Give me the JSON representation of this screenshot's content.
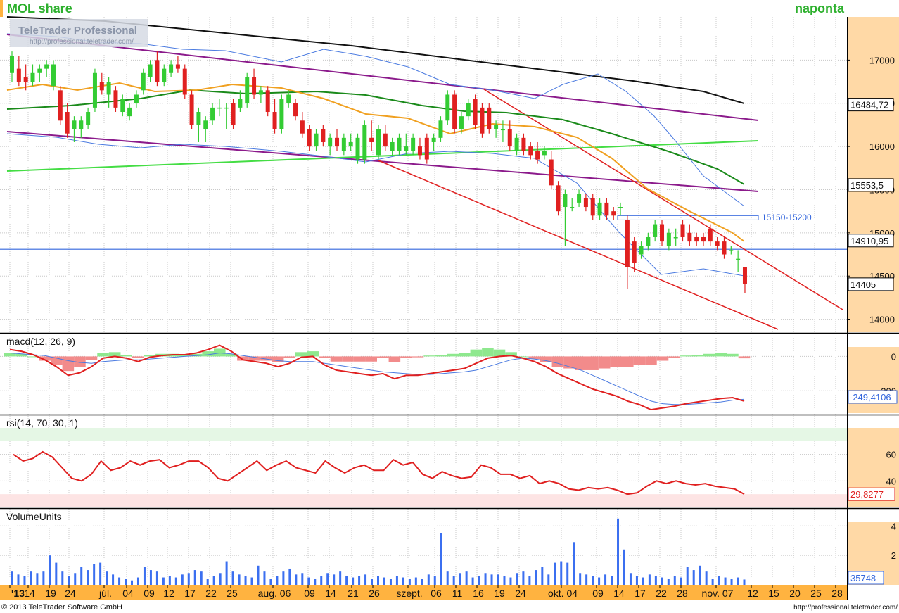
{
  "header": {
    "title": "MOL share",
    "period_label": "naponta",
    "watermark_line1": "TeleTrader Professional",
    "watermark_line2": "http://professional.teletrader.com/"
  },
  "footer": {
    "copyright": "© 2013 TeleTrader Software GmbH",
    "url": "http://professional.teletrader.com/"
  },
  "colors": {
    "up": "#33cc33",
    "down": "#e02020",
    "ma_black": "#111111",
    "ma_dark_green": "#1a8a1a",
    "ma_orange": "#f0a020",
    "bollinger": "#4a7ae0",
    "channel": "#8b1a8b",
    "trend_red": "#e02020",
    "support_blue": "#3366dd",
    "light_green": "#44dd44",
    "price_axis_bg": "#ffd9a6",
    "date_axis_bg": "#ffb340"
  },
  "chart_data": [
    {
      "type": "candlestick",
      "panel": "price",
      "ylim": [
        13850,
        17500
      ],
      "yticks": [
        14000,
        14500,
        15000,
        15500,
        16000,
        16500,
        17000
      ],
      "price_labels": [
        {
          "text": "16484,72",
          "value": 16484.72
        },
        {
          "text": "15553,5",
          "value": 15553.5
        },
        {
          "text": "14910,95",
          "value": 14910.95
        },
        {
          "text": "14405",
          "value": 14405
        }
      ],
      "annotation": {
        "text": "15150-15200",
        "low": 15150,
        "high": 15200
      },
      "support_level": 14810,
      "candles": [
        {
          "o": 16850,
          "h": 17100,
          "l": 16750,
          "c": 17050
        },
        {
          "o": 16900,
          "h": 17050,
          "l": 16700,
          "c": 16750
        },
        {
          "o": 16800,
          "h": 16950,
          "l": 16650,
          "c": 16750
        },
        {
          "o": 16750,
          "h": 16950,
          "l": 16700,
          "c": 16850
        },
        {
          "o": 16850,
          "h": 16950,
          "l": 16750,
          "c": 16900
        },
        {
          "o": 16900,
          "h": 17000,
          "l": 16800,
          "c": 16950
        },
        {
          "o": 16700,
          "h": 17000,
          "l": 16650,
          "c": 16950
        },
        {
          "o": 16650,
          "h": 16700,
          "l": 16250,
          "c": 16300
        },
        {
          "o": 16400,
          "h": 16500,
          "l": 16100,
          "c": 16150
        },
        {
          "o": 16200,
          "h": 16350,
          "l": 16050,
          "c": 16300
        },
        {
          "o": 16200,
          "h": 16350,
          "l": 16100,
          "c": 16300
        },
        {
          "o": 16250,
          "h": 16450,
          "l": 16200,
          "c": 16400
        },
        {
          "o": 16450,
          "h": 16900,
          "l": 16400,
          "c": 16850
        },
        {
          "o": 16750,
          "h": 16850,
          "l": 16600,
          "c": 16650
        },
        {
          "o": 16600,
          "h": 16800,
          "l": 16450,
          "c": 16750
        },
        {
          "o": 16650,
          "h": 16700,
          "l": 16400,
          "c": 16450
        },
        {
          "o": 16400,
          "h": 16600,
          "l": 16350,
          "c": 16550
        },
        {
          "o": 16350,
          "h": 16500,
          "l": 16300,
          "c": 16450
        },
        {
          "o": 16500,
          "h": 16650,
          "l": 16450,
          "c": 16600
        },
        {
          "o": 16650,
          "h": 16900,
          "l": 16600,
          "c": 16850
        },
        {
          "o": 16800,
          "h": 17000,
          "l": 16750,
          "c": 16950
        },
        {
          "o": 17000,
          "h": 17100,
          "l": 16700,
          "c": 16750
        },
        {
          "o": 16750,
          "h": 16950,
          "l": 16700,
          "c": 16900
        },
        {
          "o": 16850,
          "h": 17000,
          "l": 16800,
          "c": 16950
        },
        {
          "o": 16950,
          "h": 17050,
          "l": 16850,
          "c": 16900
        },
        {
          "o": 16900,
          "h": 16950,
          "l": 16550,
          "c": 16600
        },
        {
          "o": 16600,
          "h": 16650,
          "l": 16200,
          "c": 16250
        },
        {
          "o": 16250,
          "h": 16450,
          "l": 16050,
          "c": 16400
        },
        {
          "o": 16200,
          "h": 16350,
          "l": 16050,
          "c": 16300
        },
        {
          "o": 16300,
          "h": 16500,
          "l": 16250,
          "c": 16450
        },
        {
          "o": 16450,
          "h": 16550,
          "l": 16350,
          "c": 16450
        },
        {
          "o": 16450,
          "h": 16500,
          "l": 16200,
          "c": 16450
        },
        {
          "o": 16500,
          "h": 16550,
          "l": 16200,
          "c": 16250
        },
        {
          "o": 16450,
          "h": 16650,
          "l": 16400,
          "c": 16550
        },
        {
          "o": 16500,
          "h": 16850,
          "l": 16450,
          "c": 16800
        },
        {
          "o": 16800,
          "h": 16900,
          "l": 16550,
          "c": 16600
        },
        {
          "o": 16600,
          "h": 16700,
          "l": 16500,
          "c": 16650
        },
        {
          "o": 16650,
          "h": 16700,
          "l": 16350,
          "c": 16400
        },
        {
          "o": 16400,
          "h": 16550,
          "l": 16150,
          "c": 16200
        },
        {
          "o": 16200,
          "h": 16600,
          "l": 16150,
          "c": 16550
        },
        {
          "o": 16500,
          "h": 16650,
          "l": 16450,
          "c": 16600
        },
        {
          "o": 16500,
          "h": 16550,
          "l": 16300,
          "c": 16350
        },
        {
          "o": 16300,
          "h": 16400,
          "l": 16100,
          "c": 16150
        },
        {
          "o": 16200,
          "h": 16250,
          "l": 15950,
          "c": 16000
        },
        {
          "o": 16000,
          "h": 16200,
          "l": 15950,
          "c": 16150
        },
        {
          "o": 16200,
          "h": 16250,
          "l": 16000,
          "c": 16050
        },
        {
          "o": 16000,
          "h": 16150,
          "l": 15900,
          "c": 16100
        },
        {
          "o": 16100,
          "h": 16200,
          "l": 15950,
          "c": 16000
        },
        {
          "o": 15950,
          "h": 16150,
          "l": 15900,
          "c": 16100
        },
        {
          "o": 16000,
          "h": 16150,
          "l": 15950,
          "c": 16050
        },
        {
          "o": 15850,
          "h": 16150,
          "l": 15800,
          "c": 16100
        },
        {
          "o": 15850,
          "h": 16300,
          "l": 15800,
          "c": 16250
        },
        {
          "o": 16100,
          "h": 16300,
          "l": 15950,
          "c": 16050
        },
        {
          "o": 15900,
          "h": 16250,
          "l": 15850,
          "c": 16200
        },
        {
          "o": 16150,
          "h": 16250,
          "l": 15950,
          "c": 16000
        },
        {
          "o": 15950,
          "h": 16100,
          "l": 15900,
          "c": 16050
        },
        {
          "o": 15950,
          "h": 16150,
          "l": 15900,
          "c": 16100
        },
        {
          "o": 15950,
          "h": 16150,
          "l": 15900,
          "c": 16000
        },
        {
          "o": 15950,
          "h": 16150,
          "l": 15900,
          "c": 16100
        },
        {
          "o": 16000,
          "h": 16100,
          "l": 15850,
          "c": 15900
        },
        {
          "o": 16100,
          "h": 16150,
          "l": 15800,
          "c": 15850
        },
        {
          "o": 16050,
          "h": 16150,
          "l": 15950,
          "c": 16100
        },
        {
          "o": 16100,
          "h": 16350,
          "l": 16050,
          "c": 16300
        },
        {
          "o": 16300,
          "h": 16650,
          "l": 16250,
          "c": 16600
        },
        {
          "o": 16600,
          "h": 16650,
          "l": 16150,
          "c": 16200
        },
        {
          "o": 16200,
          "h": 16400,
          "l": 16150,
          "c": 16350
        },
        {
          "o": 16350,
          "h": 16550,
          "l": 16300,
          "c": 16500
        },
        {
          "o": 16550,
          "h": 16600,
          "l": 16200,
          "c": 16250
        },
        {
          "o": 16450,
          "h": 16500,
          "l": 16100,
          "c": 16150
        },
        {
          "o": 16450,
          "h": 16500,
          "l": 16150,
          "c": 16200
        },
        {
          "o": 16200,
          "h": 16300,
          "l": 16100,
          "c": 16250
        },
        {
          "o": 16200,
          "h": 16300,
          "l": 16050,
          "c": 16200
        },
        {
          "o": 16200,
          "h": 16300,
          "l": 15950,
          "c": 16000
        },
        {
          "o": 15950,
          "h": 16150,
          "l": 15900,
          "c": 16100
        },
        {
          "o": 16100,
          "h": 16150,
          "l": 15900,
          "c": 15950
        },
        {
          "o": 16000,
          "h": 16050,
          "l": 15850,
          "c": 15900
        },
        {
          "o": 15950,
          "h": 16050,
          "l": 15800,
          "c": 15850
        },
        {
          "o": 15900,
          "h": 16000,
          "l": 15850,
          "c": 15950
        },
        {
          "o": 15850,
          "h": 15950,
          "l": 15500,
          "c": 15550
        },
        {
          "o": 15550,
          "h": 15600,
          "l": 15200,
          "c": 15250
        },
        {
          "o": 15300,
          "h": 15500,
          "l": 14850,
          "c": 15450
        },
        {
          "o": 15300,
          "h": 15400,
          "l": 15250,
          "c": 15300
        },
        {
          "o": 15350,
          "h": 15500,
          "l": 15300,
          "c": 15450
        },
        {
          "o": 15400,
          "h": 15450,
          "l": 15250,
          "c": 15300
        },
        {
          "o": 15400,
          "h": 15450,
          "l": 15150,
          "c": 15200
        },
        {
          "o": 15200,
          "h": 15400,
          "l": 15150,
          "c": 15350
        },
        {
          "o": 15350,
          "h": 15400,
          "l": 15150,
          "c": 15200
        },
        {
          "o": 15250,
          "h": 15300,
          "l": 15150,
          "c": 15200
        },
        {
          "o": 15300,
          "h": 15350,
          "l": 15200,
          "c": 15300
        },
        {
          "o": 15150,
          "h": 15200,
          "l": 14350,
          "c": 14600
        },
        {
          "o": 14900,
          "h": 14950,
          "l": 14550,
          "c": 14650
        },
        {
          "o": 14750,
          "h": 14900,
          "l": 14700,
          "c": 14850
        },
        {
          "o": 14850,
          "h": 15000,
          "l": 14800,
          "c": 14950
        },
        {
          "o": 14950,
          "h": 15150,
          "l": 14900,
          "c": 15100
        },
        {
          "o": 15100,
          "h": 15150,
          "l": 14850,
          "c": 14900
        },
        {
          "o": 14850,
          "h": 15050,
          "l": 14800,
          "c": 15000
        },
        {
          "o": 14950,
          "h": 15050,
          "l": 14850,
          "c": 14950
        },
        {
          "o": 15100,
          "h": 15150,
          "l": 14900,
          "c": 14950
        },
        {
          "o": 15000,
          "h": 15100,
          "l": 14850,
          "c": 14900
        },
        {
          "o": 14950,
          "h": 15000,
          "l": 14850,
          "c": 14900
        },
        {
          "o": 14950,
          "h": 15000,
          "l": 14850,
          "c": 14900
        },
        {
          "o": 15050,
          "h": 15100,
          "l": 14850,
          "c": 14900
        },
        {
          "o": 14900,
          "h": 14950,
          "l": 14800,
          "c": 14850
        },
        {
          "o": 14900,
          "h": 14950,
          "l": 14700,
          "c": 14750
        },
        {
          "o": 14800,
          "h": 14850,
          "l": 14750,
          "c": 14800
        },
        {
          "o": 14700,
          "h": 14800,
          "l": 14550,
          "c": 14700
        },
        {
          "o": 14600,
          "h": 14600,
          "l": 14300,
          "c": 14405
        }
      ]
    },
    {
      "type": "line",
      "panel": "macd",
      "title": "macd(12, 26, 9)",
      "ylim": [
        -330,
        55
      ],
      "yticks": [
        0,
        -200
      ],
      "ytick_labels": [
        "0",
        "200"
      ],
      "last_label": "-249,4106",
      "macd": [
        40,
        30,
        10,
        -20,
        -60,
        -110,
        -95,
        -60,
        -10,
        0,
        -10,
        -30,
        -5,
        5,
        10,
        10,
        20,
        40,
        65,
        30,
        -20,
        -30,
        -40,
        -60,
        -40,
        -5,
        0,
        -50,
        -80,
        -90,
        -100,
        -110,
        -100,
        -130,
        -110,
        -110,
        -100,
        -90,
        -80,
        -70,
        -40,
        -10,
        0,
        5,
        -10,
        -30,
        -60,
        -100,
        -130,
        -160,
        -190,
        -210,
        -230,
        -260,
        -280,
        -310,
        -300,
        -290,
        -275,
        -265,
        -255,
        -245,
        -240,
        -260
      ],
      "signal": [
        20,
        15,
        10,
        5,
        -10,
        -25,
        -35,
        -40,
        -30,
        -25,
        -20,
        -20,
        -15,
        -10,
        -5,
        0,
        5,
        10,
        20,
        15,
        5,
        -5,
        -15,
        -25,
        -30,
        -30,
        -30,
        -40,
        -50,
        -60,
        -70,
        -80,
        -90,
        -95,
        -100,
        -105,
        -105,
        -100,
        -95,
        -90,
        -80,
        -60,
        -40,
        -20,
        -10,
        -15,
        -25,
        -40,
        -60,
        -80,
        -110,
        -140,
        -170,
        -200,
        -230,
        -260,
        -275,
        -280,
        -280,
        -275,
        -270,
        -265,
        -255,
        -249
      ]
    },
    {
      "type": "line",
      "panel": "rsi",
      "title": "rsi(14, 70, 30, 1)",
      "ylim": [
        20,
        80
      ],
      "yticks": [
        40,
        60
      ],
      "bands": [
        30,
        70
      ],
      "last_label": "29,8277",
      "values": [
        60,
        55,
        57,
        62,
        58,
        50,
        42,
        40,
        45,
        55,
        48,
        50,
        55,
        52,
        55,
        56,
        50,
        52,
        55,
        55,
        50,
        42,
        40,
        45,
        50,
        55,
        48,
        52,
        55,
        50,
        48,
        46,
        55,
        50,
        46,
        50,
        52,
        48,
        48,
        56,
        52,
        54,
        45,
        42,
        47,
        44,
        42,
        43,
        52,
        50,
        45,
        45,
        42,
        44,
        38,
        40,
        38,
        34,
        33,
        35,
        34,
        35,
        33,
        30,
        31,
        36,
        40,
        38,
        40,
        38,
        37,
        38,
        36,
        35,
        34,
        30
      ]
    },
    {
      "type": "bar",
      "panel": "volume",
      "title": "VolumeUnits",
      "ylim": [
        0,
        4.3
      ],
      "yticks": [
        2,
        4
      ],
      "last_label": "35748",
      "values": [
        0.9,
        0.7,
        0.6,
        0.9,
        0.8,
        0.9,
        2.0,
        1.5,
        0.9,
        0.6,
        0.8,
        1.2,
        1.0,
        1.4,
        1.5,
        0.9,
        0.7,
        0.5,
        0.4,
        0.3,
        0.5,
        1.2,
        1.0,
        0.9,
        0.5,
        0.6,
        0.5,
        0.7,
        0.8,
        1.0,
        0.9,
        0.4,
        0.6,
        0.8,
        1.6,
        0.9,
        0.7,
        0.6,
        0.5,
        1.3,
        0.9,
        0.4,
        0.6,
        0.9,
        1.1,
        0.7,
        0.8,
        0.5,
        0.4,
        0.6,
        0.8,
        0.7,
        0.9,
        0.6,
        0.5,
        0.6,
        0.7,
        0.4,
        0.6,
        0.5,
        0.4,
        0.6,
        0.5,
        0.4,
        0.5,
        0.4,
        0.7,
        0.6,
        3.5,
        0.9,
        0.6,
        0.8,
        0.9,
        0.5,
        0.6,
        0.8,
        0.7,
        0.7,
        0.6,
        0.5,
        0.8,
        0.9,
        0.6,
        1.0,
        1.2,
        0.7,
        1.5,
        1.6,
        1.5,
        2.9,
        0.8,
        0.7,
        0.6,
        0.5,
        0.7,
        0.6,
        4.5,
        2.4,
        0.8,
        0.6,
        0.5,
        0.7,
        0.6,
        0.5,
        0.4,
        0.6,
        0.5,
        1.2,
        1.0,
        1.3,
        0.9,
        0.4,
        0.6,
        0.5,
        0.4,
        0.5,
        0.36
      ]
    }
  ],
  "date_axis": {
    "labels": [
      "'13",
      "14",
      "19",
      "24",
      "júl.",
      "04",
      "09",
      "12",
      "17",
      "22",
      "25",
      "aug. 06",
      "09",
      "14",
      "21",
      "26",
      "szept.",
      "06",
      "11",
      "16",
      "19",
      "24",
      "okt. 04",
      "09",
      "14",
      "17",
      "22",
      "28",
      "nov. 07",
      "12",
      "15",
      "20",
      "25",
      "28"
    ]
  }
}
